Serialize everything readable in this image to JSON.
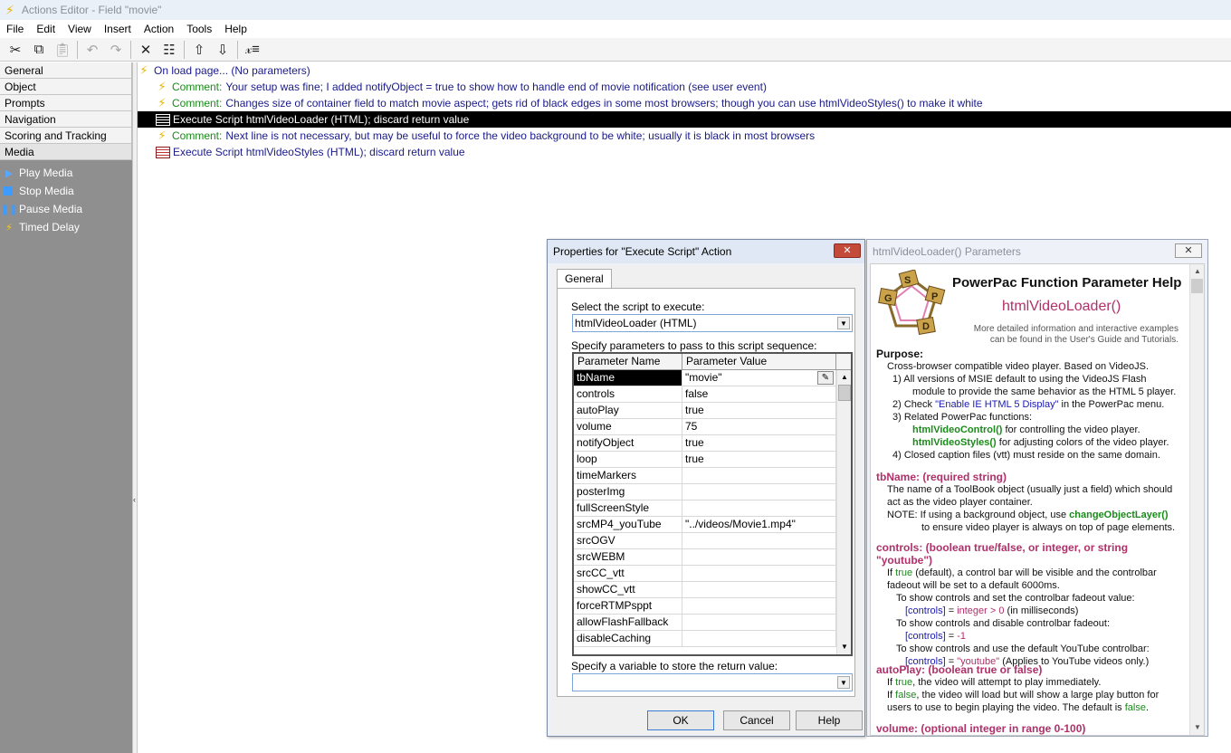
{
  "window": {
    "title": "Actions Editor - Field \"movie\""
  },
  "menu": [
    "File",
    "Edit",
    "View",
    "Insert",
    "Action",
    "Tools",
    "Help"
  ],
  "categories": [
    "General",
    "Object",
    "Prompts",
    "Navigation",
    "Scoring and Tracking",
    "Media"
  ],
  "media_items": [
    "Play Media",
    "Stop Media",
    "Pause Media",
    "Timed Delay"
  ],
  "actions": {
    "onload": "On load page... (No parameters)",
    "c1_label": "Comment:",
    "c1_text": "Your setup was fine; I added notifyObject = true to show how to handle end of movie notification (see user event)",
    "c2_label": "Comment:",
    "c2_text": "Changes size of container field to match movie aspect; gets rid of black edges in some most browsers; though you can use htmlVideoStyles() to make it white",
    "exec1": "Execute Script htmlVideoLoader (HTML); discard return value",
    "c3_label": "Comment:",
    "c3_text": "Next line is not necessary, but may be useful to force the video background to be white; usually it is black in most browsers",
    "exec2": "Execute Script htmlVideoStyles (HTML); discard return value"
  },
  "dialog": {
    "title": "Properties for \"Execute Script\" Action",
    "close": "✕",
    "tab": "General",
    "select_label": "Select the script to execute:",
    "select_value": "htmlVideoLoader (HTML)",
    "params_label": "Specify parameters to pass to this script sequence:",
    "col_name": "Parameter Name",
    "col_value": "Parameter Value",
    "rows": [
      [
        "tbName",
        "\"movie\""
      ],
      [
        "controls",
        "false"
      ],
      [
        "autoPlay",
        "true"
      ],
      [
        "volume",
        "75"
      ],
      [
        "notifyObject",
        "true"
      ],
      [
        "loop",
        "true"
      ],
      [
        "timeMarkers",
        ""
      ],
      [
        "posterImg",
        ""
      ],
      [
        "fullScreenStyle",
        ""
      ],
      [
        "srcMP4_youTube",
        "\"../videos/Movie1.mp4\""
      ],
      [
        "srcOGV",
        ""
      ],
      [
        "srcWEBM",
        ""
      ],
      [
        "srcCC_vtt",
        ""
      ],
      [
        "showCC_vtt",
        ""
      ],
      [
        "forceRTMPsppt",
        ""
      ],
      [
        "allowFlashFallback",
        ""
      ],
      [
        "disableCaching",
        ""
      ]
    ],
    "return_label": "Specify a variable to store the return value:",
    "return_value": "",
    "ok": "OK",
    "cancel": "Cancel",
    "help": "Help"
  },
  "help": {
    "title": "htmlVideoLoader() Parameters",
    "close": "✕",
    "logo_letters": [
      "S",
      "P",
      "D",
      "G"
    ],
    "heading": "PowerPac Function Parameter Help",
    "func": "htmlVideoLoader()",
    "more1": "More detailed information and interactive examples",
    "more2": "can be found in the User's Guide and Tutorials.",
    "purpose": "Purpose:",
    "p1": "Cross-browser compatible video player. Based on VideoJS.",
    "p2": "1)  All versions of MSIE default to using the VideoJS Flash",
    "p3": "module to provide the same behavior as the HTML 5 player.",
    "p4a": "2)  Check ",
    "p4b": "\"Enable IE HTML 5 Display\"",
    "p4c": " in the PowerPac menu.",
    "p5": "3)  Related PowerPac functions:",
    "p6a": "htmlVideoControl()",
    "p6b": " for controlling the video player.",
    "p7a": "htmlVideoStyles()",
    "p7b": " for adjusting colors of the video player.",
    "p8": "4)  Closed caption files (vtt) must reside on the same domain.",
    "tb_head": "tbName: (required string)",
    "tb1": "The name of a ToolBook object (usually just a field) which should",
    "tb2": "act as the video player container.",
    "tb3a": "NOTE:   If using a background object, use ",
    "tb3b": "changeObjectLayer()",
    "tb4": "to ensure video player is always on top of page elements.",
    "ct_head": "controls: (boolean true/false, or integer, or string \"youtube\")",
    "ct1a": "If ",
    "ct1b": "true",
    "ct1c": " (default), a control bar will be visible and the controlbar",
    "ct2": "fadeout will be set to a default 6000ms.",
    "ct3": "To show controls and set the controlbar fadeout value:",
    "ct4a": "[controls]",
    "ct4b": " = ",
    "ct4c": "integer > 0",
    "ct4d": " (in milliseconds)",
    "ct5": "To show controls and disable controlbar fadeout:",
    "ct6a": "[controls]",
    "ct6b": " = ",
    "ct6c": "-1",
    "ct7": "To show controls and use the default YouTube controlbar:",
    "ct8a": "[controls]",
    "ct8b": " = ",
    "ct8c": "\"youtube\"",
    "ct8d": "    (Applies to YouTube videos only.)",
    "ap_head": "autoPlay: (boolean true or false)",
    "ap1a": "If ",
    "ap1b": "true",
    "ap1c": ", the video will attempt to play immediately.",
    "ap2a": "If ",
    "ap2b": "false",
    "ap2c": ", the video will load but will show a large play button for",
    "ap3a": "users to use to begin playing the video. The default is ",
    "ap3b": "false",
    "ap3c": ".",
    "vol_head": "volume: (optional integer in range 0-100)"
  }
}
